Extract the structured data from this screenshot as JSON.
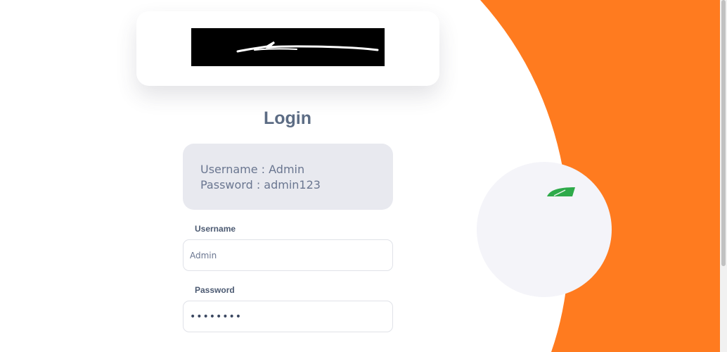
{
  "logo": {
    "icon": "signature-logo-icon"
  },
  "login": {
    "title": "Login",
    "credentials": {
      "username_line": "Username : Admin",
      "password_line": "Password : admin123"
    },
    "username": {
      "label": "Username",
      "value": "Admin"
    },
    "password": {
      "label": "Password",
      "value": "admin123"
    }
  },
  "colors": {
    "accent": "#ff7b1f",
    "title": "#5c6c84",
    "credentials_bg": "#e8e9ef",
    "illustration_leaf": "#2eaa4a"
  }
}
